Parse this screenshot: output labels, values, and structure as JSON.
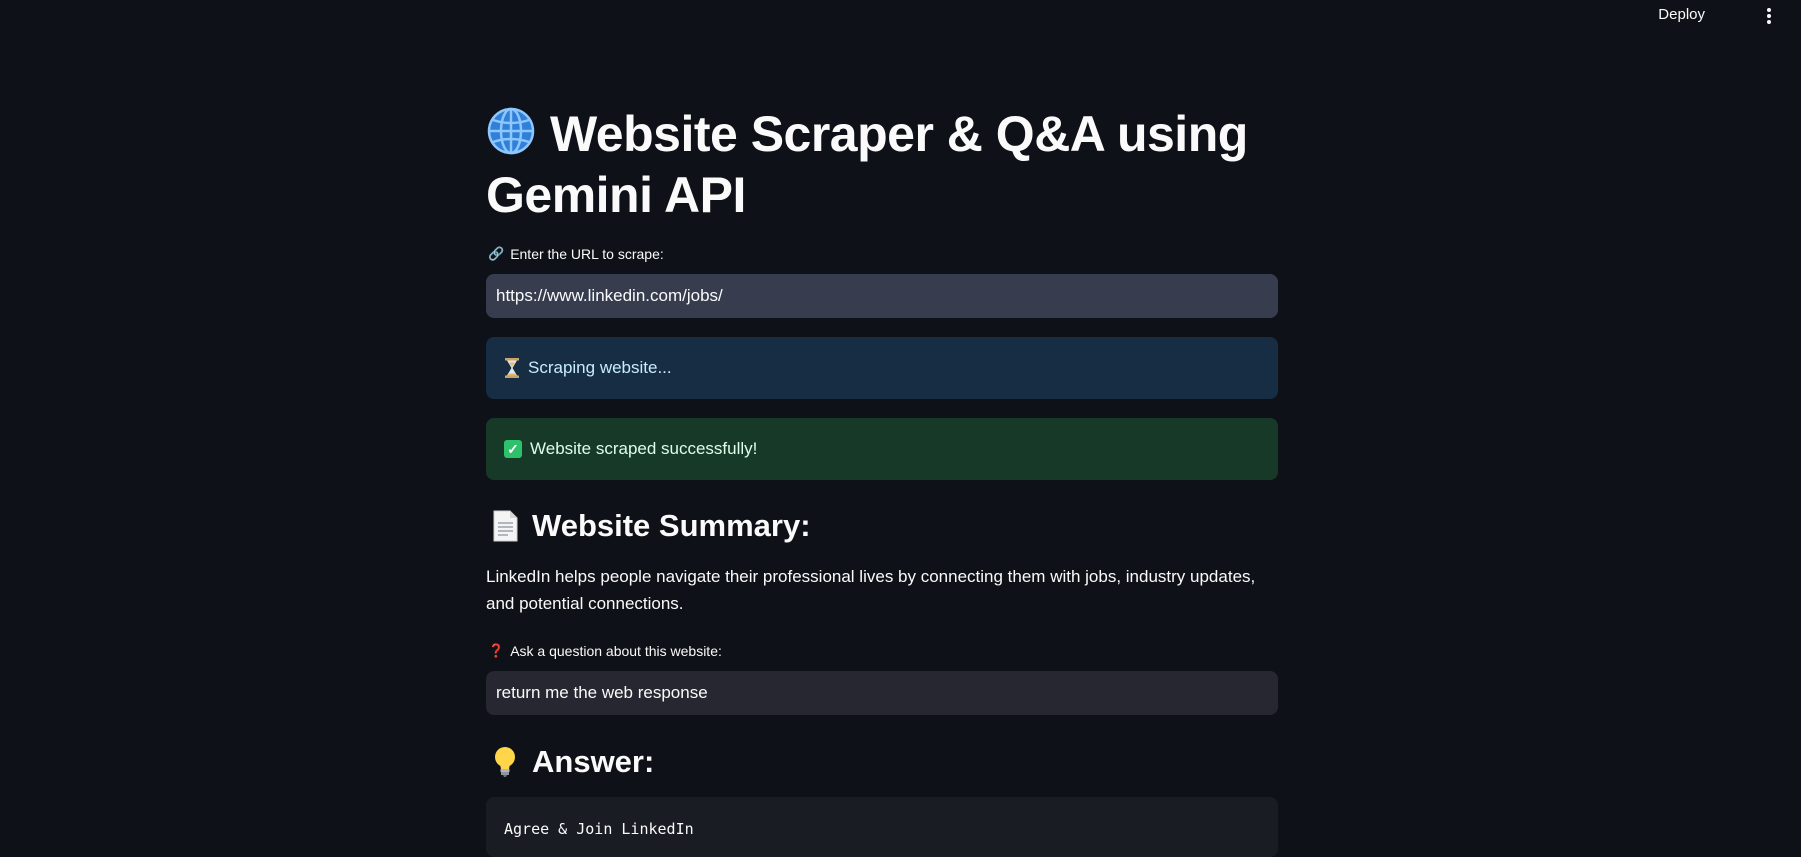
{
  "toolbar": {
    "deploy_label": "Deploy",
    "menu_icon": "kebab-menu-icon"
  },
  "page": {
    "title": "Website Scraper & Q&A using Gemini API",
    "title_icon": "globe-icon"
  },
  "url_field": {
    "label": "Enter the URL to scrape:",
    "label_icon": "link-icon",
    "value": "https://www.linkedin.com/jobs/"
  },
  "status": {
    "info_text": "Scraping website...",
    "info_icon": "hourglass-icon",
    "success_text": "Website scraped successfully!",
    "success_icon": "check-icon"
  },
  "summary": {
    "heading": "Website Summary:",
    "heading_icon": "document-icon",
    "text": "LinkedIn helps people navigate their professional lives by connecting them with jobs, industry updates, and potential connections."
  },
  "question_field": {
    "label": "Ask a question about this website:",
    "label_icon": "question-mark-icon",
    "value": "return me the web response"
  },
  "answer": {
    "heading": "Answer:",
    "heading_icon": "lightbulb-icon",
    "text": "Agree & Join LinkedIn"
  },
  "colors": {
    "background": "#0e1117",
    "info_bg": "#172d43",
    "success_bg": "#173928",
    "input_bg": "#262730",
    "input_active_bg": "#373d4f"
  }
}
